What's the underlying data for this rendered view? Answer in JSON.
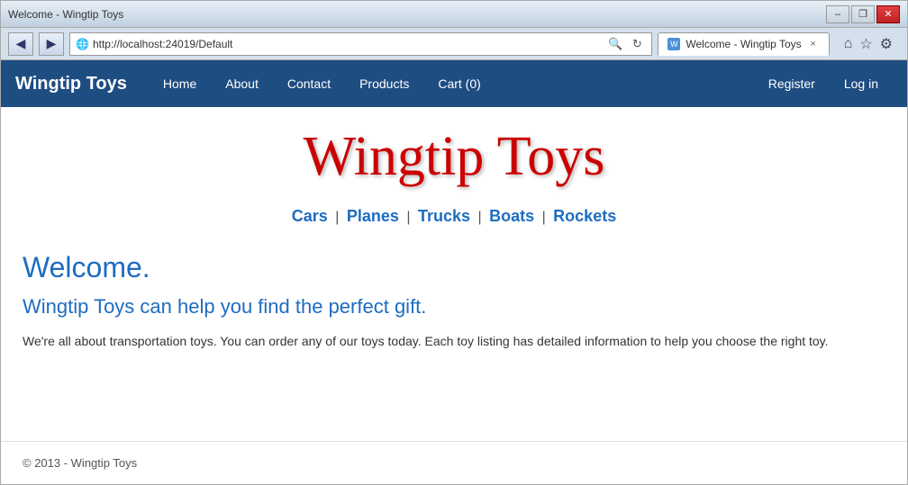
{
  "window": {
    "title": "Welcome - Wingtip Toys",
    "controls": {
      "minimize": "–",
      "restore": "❐",
      "close": "✕"
    }
  },
  "addressbar": {
    "url": "http://localhost:24019/Default",
    "refresh_icon": "↻",
    "back_icon": "◀",
    "forward_icon": "▶"
  },
  "tab": {
    "label": "Welcome - Wingtip Toys",
    "close": "×"
  },
  "toolbar_icons": {
    "home": "⌂",
    "star": "☆",
    "settings": "⚙"
  },
  "site": {
    "brand": "Wingtip Toys",
    "title_display": "Wingtip Toys",
    "tagline": "Wingtip Toys can help you find the perfect gift.",
    "welcome": "Welcome.",
    "description": "We're all about transportation toys. You can order any of our toys today. Each toy listing has detailed information to help you choose the right toy.",
    "footer": "© 2013 - Wingtip Toys"
  },
  "nav": {
    "links": [
      {
        "label": "Home",
        "href": "#"
      },
      {
        "label": "About",
        "href": "#"
      },
      {
        "label": "Contact",
        "href": "#"
      },
      {
        "label": "Products",
        "href": "#"
      },
      {
        "label": "Cart (0)",
        "href": "#"
      }
    ],
    "right_links": [
      {
        "label": "Register",
        "href": "#"
      },
      {
        "label": "Log in",
        "href": "#"
      }
    ]
  },
  "categories": [
    {
      "label": "Cars",
      "href": "#"
    },
    {
      "label": "Planes",
      "href": "#"
    },
    {
      "label": "Trucks",
      "href": "#"
    },
    {
      "label": "Boats",
      "href": "#"
    },
    {
      "label": "Rockets",
      "href": "#"
    }
  ]
}
